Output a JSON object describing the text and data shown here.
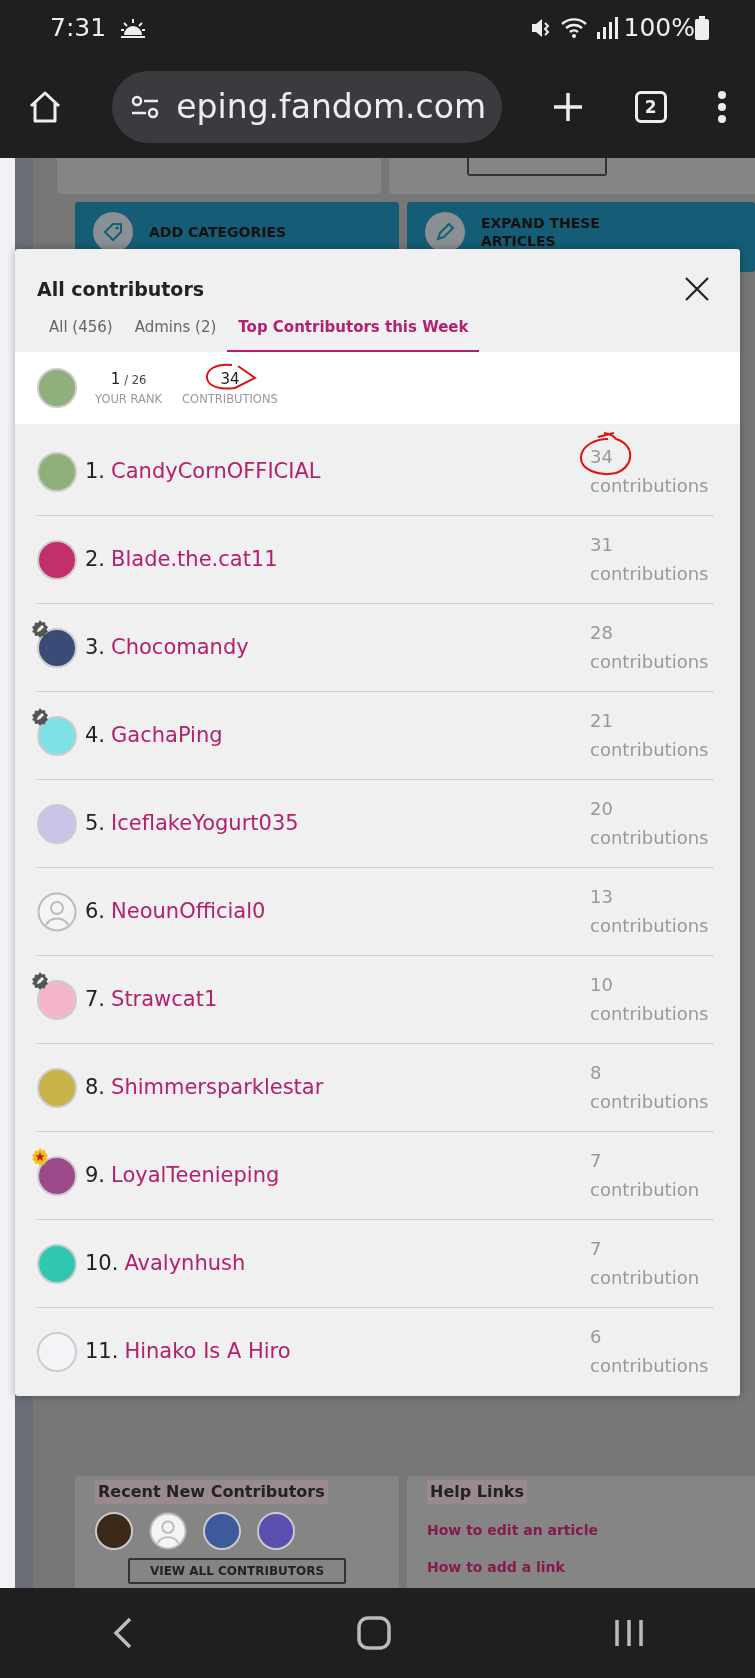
{
  "status_bar": {
    "time": "7:31",
    "battery": "100%"
  },
  "browser": {
    "url": "eping.fandom.com",
    "tab_count": "2"
  },
  "background": {
    "cards": [
      {
        "label": "ADD CATEGORIES",
        "kind": "tag"
      },
      {
        "label": "EXPAND THESE ARTICLES",
        "kind": "pencil"
      }
    ],
    "recent": {
      "heading": "Recent New Contributors",
      "button": "VIEW ALL CONTRIBUTORS",
      "avatars": [
        {
          "kind": "picture",
          "color": "#3b2a18"
        },
        {
          "kind": "default"
        },
        {
          "kind": "picture",
          "color": "#3d5a9a"
        },
        {
          "kind": "picture",
          "color": "#5b4fb0"
        }
      ]
    },
    "help": {
      "heading": "Help Links",
      "links": [
        "How to edit an article",
        "How to add a link"
      ]
    }
  },
  "modal": {
    "title": "All contributors",
    "tabs": [
      {
        "label": "All (456)",
        "selected": false
      },
      {
        "label": "Admins (2)",
        "selected": false
      },
      {
        "label": "Top Contributors this Week",
        "selected": true
      }
    ],
    "summary": {
      "avatar": {
        "kind": "picture",
        "color": "#8fb07a"
      },
      "rank": "1",
      "rank_total": "/ 26",
      "rank_label": "YOUR RANK",
      "contributions": "34",
      "contributions_label": "CONTRIBUTIONS",
      "annotated": true
    },
    "members": [
      {
        "rank": "1.",
        "name": "CandyCornOFFICIAL",
        "count": "34",
        "unit": "contributions",
        "avatar": {
          "kind": "picture",
          "color": "#8fb07a"
        },
        "annotated": true
      },
      {
        "rank": "2.",
        "name": "Blade.the.cat11",
        "count": "31",
        "unit": "contributions",
        "avatar": {
          "kind": "picture",
          "color": "#c2306a"
        }
      },
      {
        "rank": "3.",
        "name": "Chocomandy",
        "count": "28",
        "unit": "contributions",
        "avatar": {
          "kind": "picture",
          "color": "#3c4a78"
        },
        "badge": {
          "kind": "pencil"
        }
      },
      {
        "rank": "4.",
        "name": "GachaPing",
        "count": "21",
        "unit": "contributions",
        "avatar": {
          "kind": "picture",
          "color": "#7fe0e6"
        },
        "badge": {
          "kind": "pencil"
        }
      },
      {
        "rank": "5.",
        "name": "IceflakeYogurt035",
        "count": "20",
        "unit": "contributions",
        "avatar": {
          "kind": "picture",
          "color": "#c8c4e8"
        }
      },
      {
        "rank": "6.",
        "name": "NeounOfficial0",
        "count": "13",
        "unit": "contributions",
        "avatar": {
          "kind": "default"
        }
      },
      {
        "rank": "7.",
        "name": "Strawcat1",
        "count": "10",
        "unit": "contributions",
        "avatar": {
          "kind": "picture",
          "color": "#f4b6c8"
        },
        "badge": {
          "kind": "pencil"
        }
      },
      {
        "rank": "8.",
        "name": "Shimmersparklestar",
        "count": "8",
        "unit": "contributions",
        "avatar": {
          "kind": "picture",
          "color": "#c9b24a"
        }
      },
      {
        "rank": "9.",
        "name": "LoyalTeenieping",
        "count": "7",
        "unit": "contribution",
        "avatar": {
          "kind": "picture",
          "color": "#9a4a8a"
        },
        "badge": {
          "kind": "star"
        }
      },
      {
        "rank": "10.",
        "name": "Avalynhush",
        "count": "7",
        "unit": "contribution",
        "avatar": {
          "kind": "picture",
          "color": "#2fc7b0"
        }
      },
      {
        "rank": "11.",
        "name": "Hinako Is A Hiro",
        "count": "6",
        "unit": "contributions",
        "avatar": {
          "kind": "picture",
          "color": "#f4f4f8"
        }
      }
    ]
  }
}
